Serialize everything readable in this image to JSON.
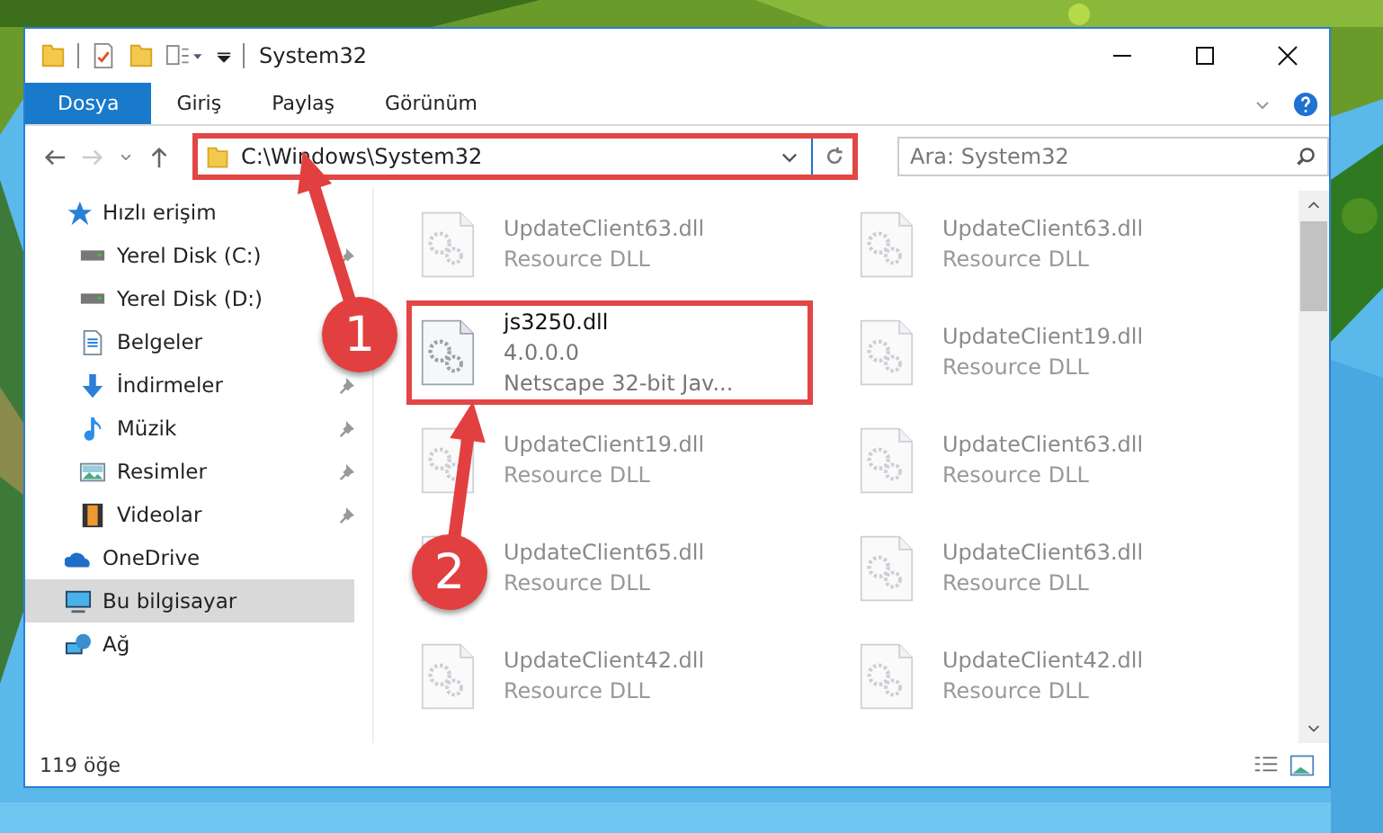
{
  "window": {
    "title": "System32"
  },
  "ribbon_tabs": [
    {
      "label": "Dosya",
      "selected": true
    },
    {
      "label": "Giriş",
      "selected": false
    },
    {
      "label": "Paylaş",
      "selected": false
    },
    {
      "label": "Görünüm",
      "selected": false
    }
  ],
  "address": {
    "value": "C:\\Windows\\System32",
    "highlighted": true
  },
  "search": {
    "placeholder": "Ara: System32"
  },
  "sidebar": {
    "items": [
      {
        "label": "Hızlı erişim",
        "selected": false,
        "children": [
          {
            "label": "Yerel Disk (C:)",
            "pinned": true,
            "selected": false
          },
          {
            "label": "Yerel Disk (D:)",
            "selected": false
          },
          {
            "label": "Belgeler",
            "selected": false
          },
          {
            "label": "İndirmeler",
            "pinned": true,
            "selected": false
          },
          {
            "label": "Müzik",
            "pinned": true,
            "selected": false
          },
          {
            "label": "Resimler",
            "pinned": true,
            "selected": false
          },
          {
            "label": "Videolar",
            "pinned": true,
            "selected": false
          }
        ]
      },
      {
        "label": "OneDrive",
        "selected": false
      },
      {
        "label": "Bu bilgisayar",
        "selected": true
      },
      {
        "label": "Ağ",
        "selected": false
      }
    ]
  },
  "files": {
    "columns": [
      [
        {
          "name": "UpdateClient63.dll",
          "lines": [
            "Resource DLL"
          ],
          "faded": true,
          "highlighted": false
        },
        {
          "name": "js3250.dll",
          "lines": [
            "4.0.0.0",
            "Netscape 32-bit Jav..."
          ],
          "faded": false,
          "highlighted": true
        },
        {
          "name": "UpdateClient19.dll",
          "lines": [
            "Resource DLL"
          ],
          "faded": true,
          "highlighted": false
        },
        {
          "name": "UpdateClient65.dll",
          "lines": [
            "Resource DLL"
          ],
          "faded": true,
          "highlighted": false
        },
        {
          "name": "UpdateClient42.dll",
          "lines": [
            "Resource DLL"
          ],
          "faded": true,
          "highlighted": false
        }
      ],
      [
        {
          "name": "UpdateClient63.dll",
          "lines": [
            "Resource DLL"
          ],
          "faded": true,
          "highlighted": false
        },
        {
          "name": "UpdateClient19.dll",
          "lines": [
            "Resource DLL"
          ],
          "faded": true,
          "highlighted": false
        },
        {
          "name": "UpdateClient63.dll",
          "lines": [
            "Resource DLL"
          ],
          "faded": true,
          "highlighted": false
        },
        {
          "name": "UpdateClient63.dll",
          "lines": [
            "Resource DLL"
          ],
          "faded": true,
          "highlighted": false
        },
        {
          "name": "UpdateClient42.dll",
          "lines": [
            "Resource DLL"
          ],
          "faded": true,
          "highlighted": false
        }
      ]
    ]
  },
  "status_bar": {
    "count": "119 öğe"
  },
  "annotations": [
    {
      "label": "1"
    },
    {
      "label": "2"
    }
  ]
}
